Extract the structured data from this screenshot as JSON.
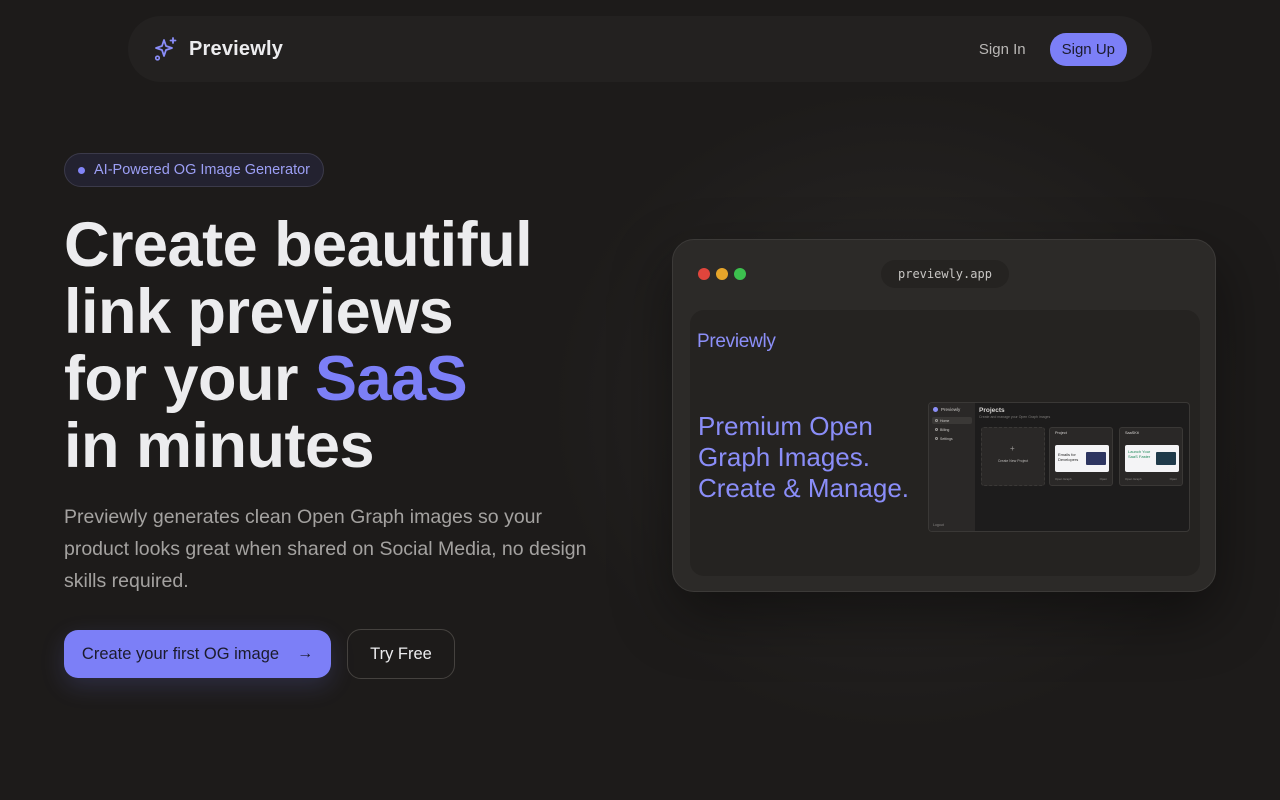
{
  "nav": {
    "brand": "Previewly",
    "signin_label": "Sign In",
    "signup_label": "Sign Up"
  },
  "hero": {
    "badge": "AI-Powered OG Image Generator",
    "headline_line1": "Create beautiful",
    "headline_line2": "link previews",
    "headline_line3_prefix": "for your ",
    "headline_line3_accent": "SaaS",
    "headline_line4": "in minutes",
    "subtext": "Previewly generates clean Open Graph images so your product looks great when shared on Social Media, no design skills required.",
    "cta_label": "Create your first OG image",
    "try_free_label": "Try Free"
  },
  "preview": {
    "url": "previewly.app",
    "brand": "Previewly",
    "headline": "Premium Open Graph Images. Create & Manage.",
    "mini": {
      "brand": "Previewly",
      "nav_items": [
        "Home",
        "Billing",
        "Settings"
      ],
      "title": "Projects",
      "subtitle": "Create and manage your Open Graph images",
      "create_label": "Create New Project",
      "projects": [
        {
          "name": "Project",
          "thumb_text": "Emails for Developers",
          "footer_left": "Open Graph",
          "footer_right": "Open"
        },
        {
          "name": "SaaSKit",
          "thumb_text": "Launch Your SaaS Faster",
          "footer_left": "Open Graph",
          "footer_right": "Open"
        }
      ],
      "logout": "Logout"
    }
  },
  "colors": {
    "background": "#1d1b1a",
    "accent": "#7c7ff7",
    "text": "#ececee",
    "muted": "#a4a2a0"
  },
  "icons": {
    "brand": "sparkles-icon",
    "cta": "arrow-right-icon"
  }
}
